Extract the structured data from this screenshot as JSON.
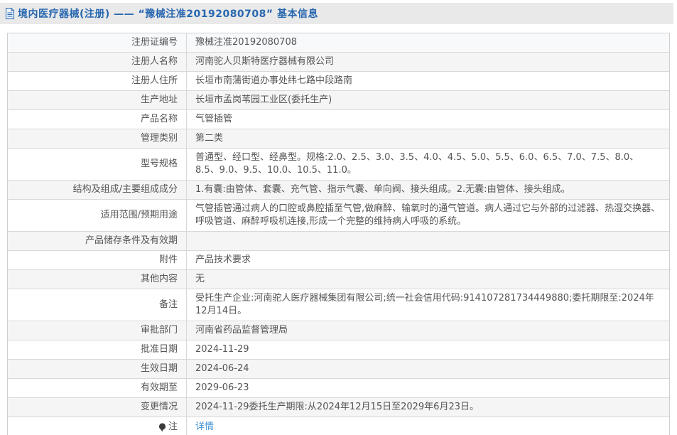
{
  "header": {
    "title": "境内医疗器械(注册) —— “豫械注准20192080708” 基本信息"
  },
  "table": {
    "rows": [
      {
        "label": "注册证编号",
        "value": "豫械注准20192080708"
      },
      {
        "label": "注册人名称",
        "value": "河南驼人贝斯特医疗器械有限公司"
      },
      {
        "label": "注册人住所",
        "value": "长垣市南蒲街道办事处纬七路中段路南"
      },
      {
        "label": "生产地址",
        "value": "长垣市孟岗苇园工业区(委托生产)"
      },
      {
        "label": "产品名称",
        "value": "气管插管"
      },
      {
        "label": "管理类别",
        "value": "第二类"
      },
      {
        "label": "型号规格",
        "value": "普通型、经口型、经鼻型。规格:2.0、2.5、3.0、3.5、4.0、4.5、5.0、5.5、6.0、6.5、7.0、7.5、8.0、8.5、9.0、9.5、10.0、10.5、11.0。"
      },
      {
        "label": "结构及组成/主要组成成分",
        "value": "1.有囊:由管体、套囊、充气管、指示气囊、单向阀、接头组成。2.无囊:由管体、接头组成。"
      },
      {
        "label": "适用范围/预期用途",
        "value": "气管插管通过病人的口腔或鼻腔插至气管,做麻醉、输氧时的通气管道。病人通过它与外部的过滤器、热湿交换器、呼吸管道、麻醉呼吸机连接,形成一个完整的维持病人呼吸的系统。"
      },
      {
        "label": "产品储存条件及有效期",
        "value": ""
      },
      {
        "label": "附件",
        "value": "产品技术要求"
      },
      {
        "label": "其他内容",
        "value": "无"
      },
      {
        "label": "备注",
        "value": "受托生产企业:河南驼人医疗器械集团有限公司;统一社会信用代码:914107281734449880;委托期限至:2024年12月14日。"
      },
      {
        "label": "审批部门",
        "value": "河南省药品监督管理局"
      },
      {
        "label": "批准日期",
        "value": "2024-11-29"
      },
      {
        "label": "生效日期",
        "value": "2024-06-24"
      },
      {
        "label": "有效期至",
        "value": "2029-06-23"
      },
      {
        "label": "变更情况",
        "value": "2024-11-29委托生产期限:从2024年12月15日至2029年6月23日。"
      },
      {
        "label": "注",
        "value": "详情",
        "link": true,
        "icon": "note-balloon-icon"
      }
    ]
  },
  "colors": {
    "accent": "#2767b0",
    "link": "#4193d5",
    "stripe": "#f5f5f5",
    "first_row": "#f8f9fb",
    "border": "#cfcfcf",
    "title_bar_bg": "#e9e9e9"
  }
}
